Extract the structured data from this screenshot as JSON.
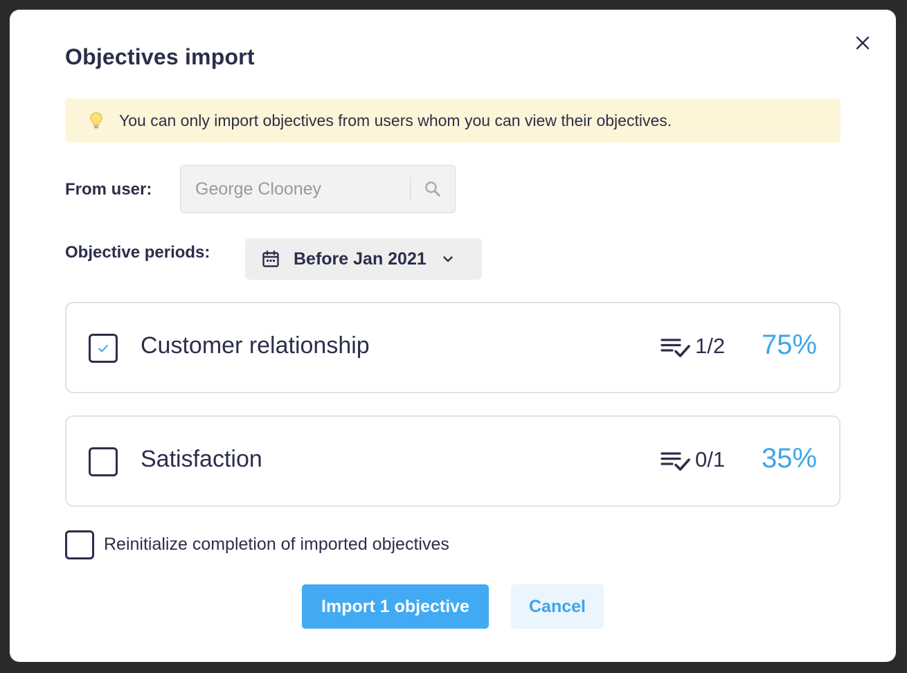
{
  "modal": {
    "title": "Objectives import",
    "notice": "You can only import objectives from users whom you can view their objectives."
  },
  "from_user": {
    "label": "From user:",
    "value": "George Clooney"
  },
  "periods": {
    "label": "Objective periods:",
    "selected": "Before Jan 2021"
  },
  "objectives": [
    {
      "name": "Customer relationship",
      "tasks": "1/2",
      "percent": "75%",
      "checked": true
    },
    {
      "name": "Satisfaction",
      "tasks": "0/1",
      "percent": "35%",
      "checked": false
    }
  ],
  "reinitialize": {
    "label": "Reinitialize completion of imported objectives",
    "checked": false
  },
  "actions": {
    "import_label": "Import 1 objective",
    "cancel_label": "Cancel"
  },
  "colors": {
    "accent": "#42aaf2",
    "percent": "#3da6e8",
    "text": "#2b2e4a",
    "notice_bg": "#fdf5d7"
  },
  "icons": [
    "close-icon",
    "lightbulb-icon",
    "search-icon",
    "calendar-icon",
    "chevron-down-icon",
    "tasks-list-icon",
    "checkmark-icon"
  ]
}
